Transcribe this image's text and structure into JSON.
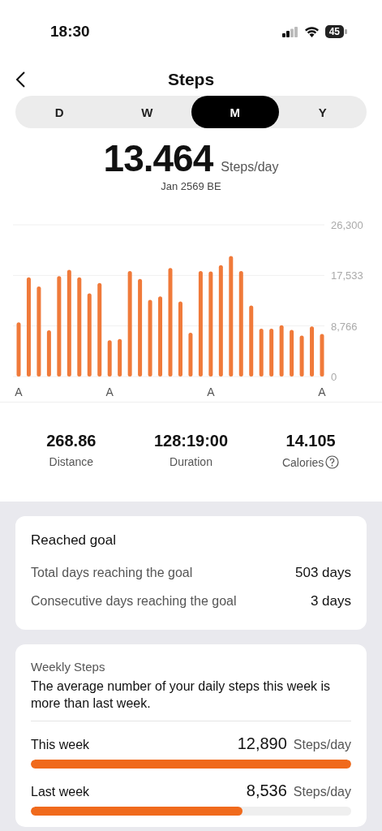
{
  "status_bar": {
    "time": "18:30",
    "battery": "45"
  },
  "header": {
    "title": "Steps"
  },
  "tabs": [
    {
      "label": "D",
      "selected": false
    },
    {
      "label": "W",
      "selected": false
    },
    {
      "label": "M",
      "selected": true
    },
    {
      "label": "Y",
      "selected": false
    }
  ],
  "summary": {
    "value": "13.464",
    "unit": "Steps/day",
    "period": "Jan 2569 BE"
  },
  "chart_data": {
    "type": "bar",
    "values": [
      9400,
      17200,
      15600,
      8000,
      17400,
      18500,
      17200,
      14400,
      16200,
      6300,
      6500,
      18300,
      16900,
      13300,
      13900,
      18800,
      13000,
      7600,
      18300,
      18200,
      19300,
      20900,
      18300,
      12300,
      8300,
      8300,
      8900,
      8100,
      7100,
      8700,
      7400
    ],
    "categories": [
      "A",
      null,
      null,
      null,
      null,
      null,
      null,
      null,
      null,
      "A",
      null,
      null,
      null,
      null,
      null,
      null,
      null,
      null,
      null,
      "A",
      null,
      null,
      null,
      null,
      null,
      null,
      null,
      null,
      null,
      null,
      "A"
    ],
    "ylim": [
      0,
      26300
    ],
    "yticks": [
      {
        "value": 0,
        "label": "0"
      },
      {
        "value": 8766,
        "label": "8,766"
      },
      {
        "value": 17533,
        "label": "17,533"
      },
      {
        "value": 26300,
        "label": "26,300"
      }
    ]
  },
  "stats": [
    {
      "value": "268.86",
      "label": "Distance",
      "info": false
    },
    {
      "value": "128:19:00",
      "label": "Duration",
      "info": false
    },
    {
      "value": "14.105",
      "label": "Calories",
      "info": true
    }
  ],
  "goal_card": {
    "title": "Reached goal",
    "rows": [
      {
        "label": "Total days reaching the goal",
        "value": "503 days"
      },
      {
        "label": "Consecutive days reaching the goal",
        "value": "3 days"
      }
    ]
  },
  "weekly_card": {
    "title": "Weekly Steps",
    "message": "The average number of your daily steps this week is more than last week.",
    "rows": [
      {
        "label": "This week",
        "value": "12,890",
        "unit": "Steps/day",
        "level": 1.0
      },
      {
        "label": "Last week",
        "value": "8,536",
        "unit": "Steps/day",
        "level": 0.66
      }
    ]
  }
}
